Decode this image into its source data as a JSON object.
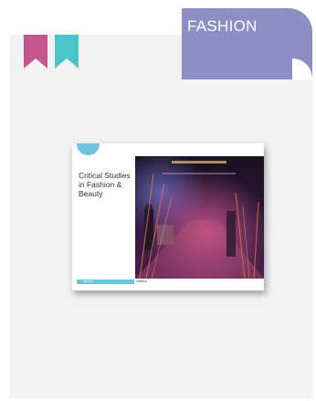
{
  "category": {
    "label": "FASHION",
    "color": "#8d8ec3"
  },
  "bookmarks": [
    {
      "name": "bookmark-pink",
      "color": "#c2578e"
    },
    {
      "name": "bookmark-teal",
      "color": "#4cc4c8"
    }
  ],
  "cover": {
    "title": "Critical Studies in Fashion & Beauty",
    "footer_left": "intellect",
    "footer_journal": "Intellect",
    "accent": "#6ec3dd"
  }
}
